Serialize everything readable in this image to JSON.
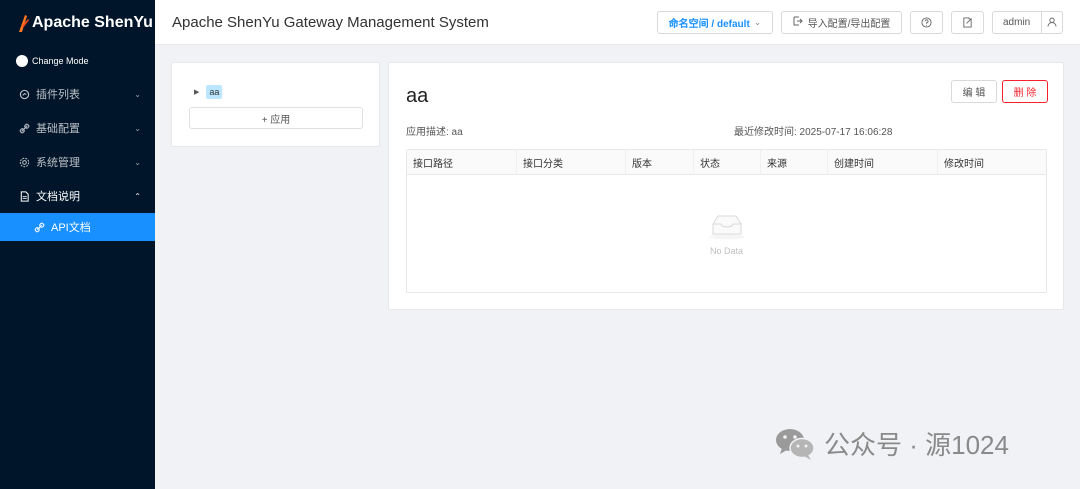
{
  "app": {
    "logo_text": "Apache ShenYu",
    "title": "Apache ShenYu Gateway Management System"
  },
  "sidebar": {
    "mode_label": "Change Mode",
    "items": [
      {
        "label": "插件列表",
        "icon": "plugin-icon"
      },
      {
        "label": "基础配置",
        "icon": "link-icon"
      },
      {
        "label": "系统管理",
        "icon": "gear-icon"
      },
      {
        "label": "文档说明",
        "icon": "document-icon",
        "open": true
      }
    ],
    "sub_item": {
      "label": "API文档",
      "icon": "link-icon"
    }
  },
  "header": {
    "namespace_label": "命名空间 / default",
    "config_label": "导入配置/导出配置",
    "user_name": "admin"
  },
  "tree": {
    "node_label": "aa",
    "add_label": "+ 应用"
  },
  "detail": {
    "title": "aa",
    "edit_label": "编 辑",
    "delete_label": "删 除",
    "description": "应用描述: aa",
    "modified": "最近修改时间: 2025-07-17 16:06:28",
    "columns": [
      "接口路径",
      "接口分类",
      "版本",
      "状态",
      "来源",
      "创建时间",
      "修改时间"
    ],
    "empty_text": "No Data"
  },
  "watermark": {
    "text": "公众号 · 源1024"
  },
  "colors": {
    "sidebar_bg": "#001529",
    "accent": "#1890ff",
    "danger": "#f5222d"
  }
}
